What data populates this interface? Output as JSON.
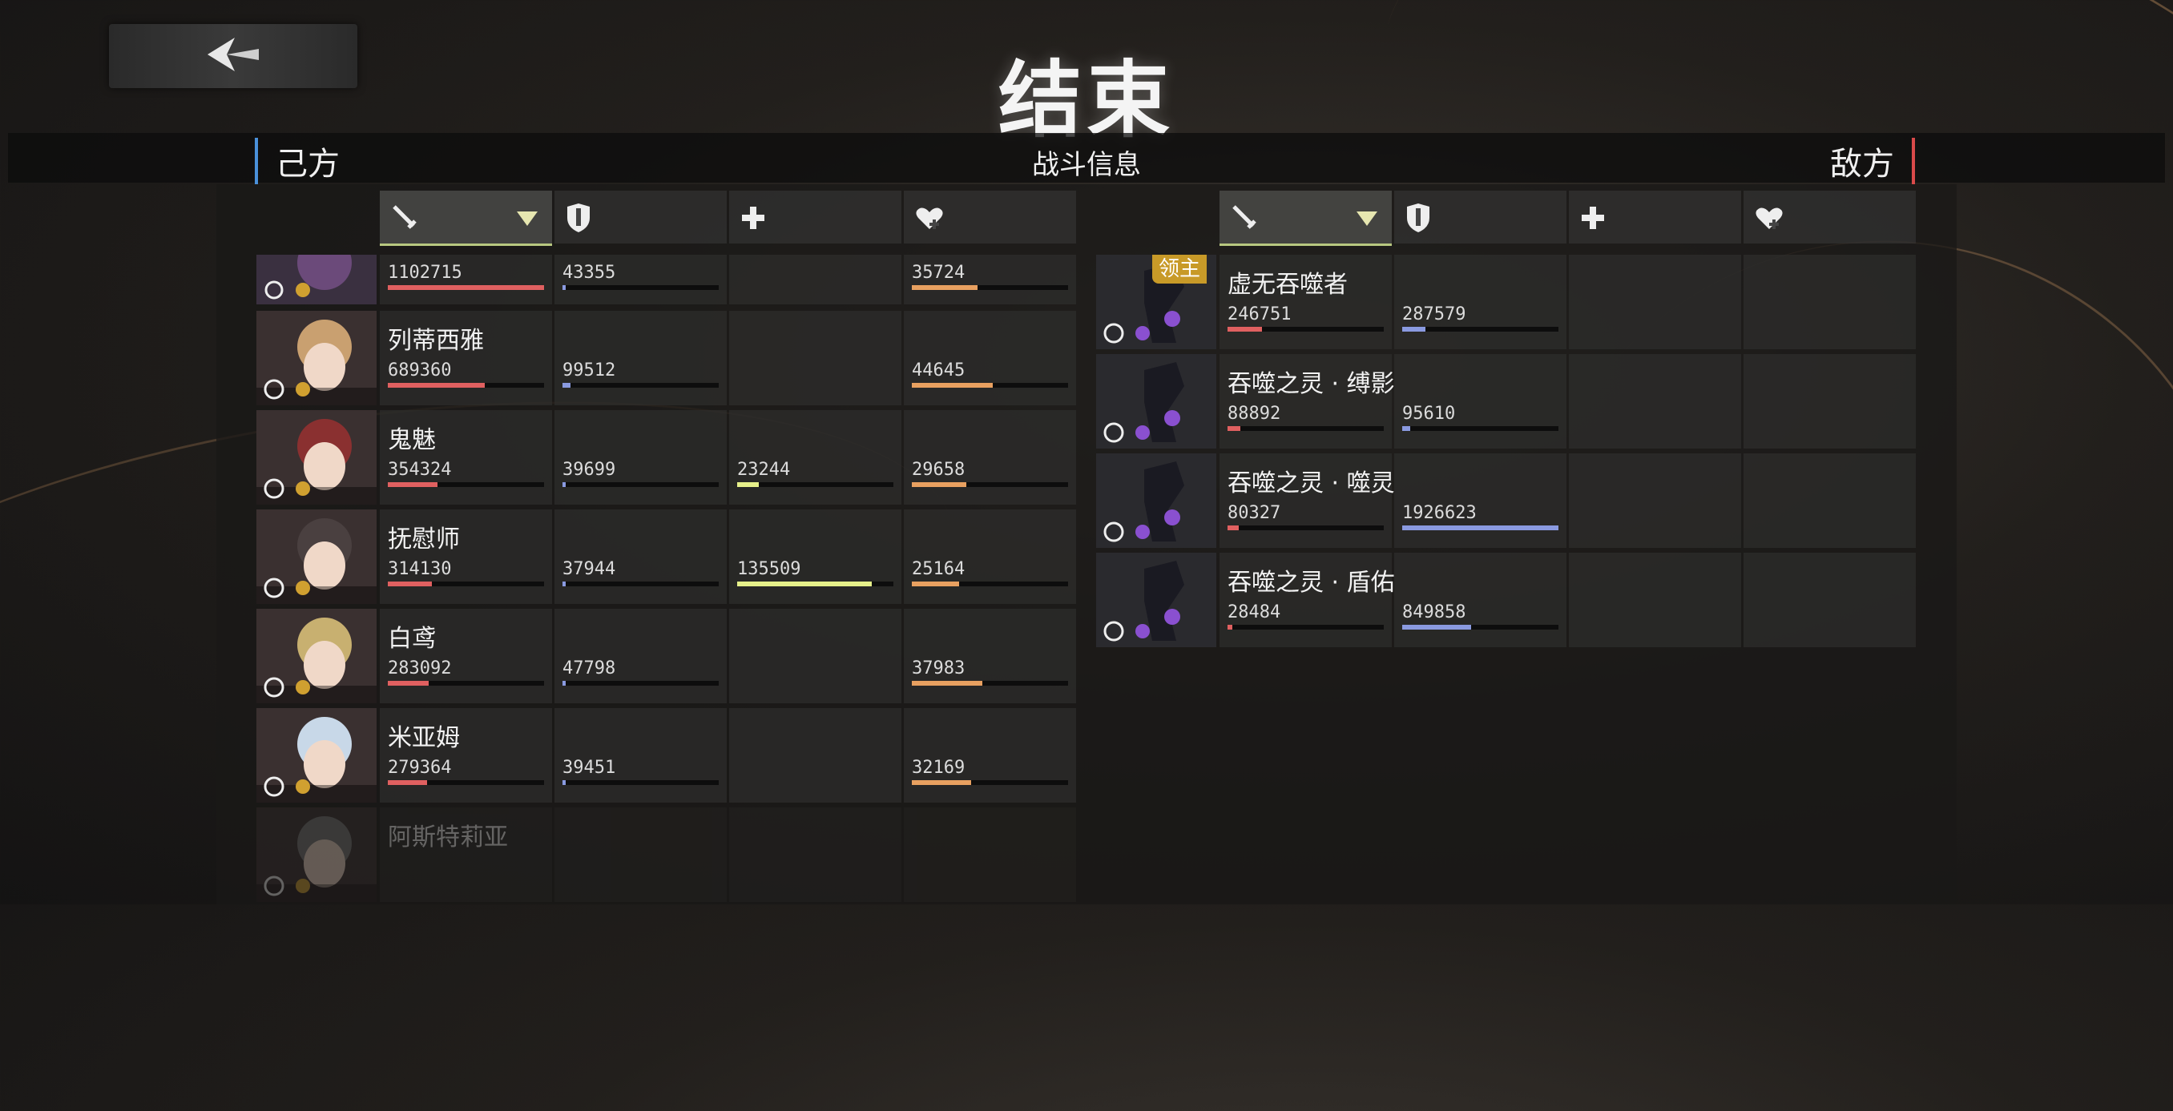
{
  "title": "结束",
  "header": {
    "ally_label": "己方",
    "center_label": "战斗信息",
    "enemy_label": "敌方"
  },
  "columns": {
    "icons": [
      "sword-icon",
      "shield-icon",
      "plus-icon",
      "heart-plus-icon"
    ],
    "sorted_column": "damage"
  },
  "colors": {
    "damage_bar": "#e06060",
    "defense_bar": "#8a9ae0",
    "heal_bar": "#e6f08a",
    "support_bar": "#e8a060"
  },
  "allies": [
    {
      "name": "",
      "damage": "1102715",
      "defense": "43355",
      "heal": "",
      "support": "35724",
      "damage_pct": 1.0,
      "defense_pct": 0.02,
      "heal_pct": 0,
      "support_pct": 0.42
    },
    {
      "name": "列蒂西雅",
      "damage": "689360",
      "defense": "99512",
      "heal": "",
      "support": "44645",
      "damage_pct": 0.62,
      "defense_pct": 0.05,
      "heal_pct": 0,
      "support_pct": 0.52
    },
    {
      "name": "鬼魅",
      "damage": "354324",
      "defense": "39699",
      "heal": "23244",
      "support": "29658",
      "damage_pct": 0.32,
      "defense_pct": 0.02,
      "heal_pct": 0.14,
      "support_pct": 0.35
    },
    {
      "name": "抚慰师",
      "damage": "314130",
      "defense": "37944",
      "heal": "135509",
      "support": "25164",
      "damage_pct": 0.28,
      "defense_pct": 0.02,
      "heal_pct": 0.86,
      "support_pct": 0.3
    },
    {
      "name": "白鸢",
      "damage": "283092",
      "defense": "47798",
      "heal": "",
      "support": "37983",
      "damage_pct": 0.26,
      "defense_pct": 0.02,
      "heal_pct": 0,
      "support_pct": 0.45
    },
    {
      "name": "米亚姆",
      "damage": "279364",
      "defense": "39451",
      "heal": "",
      "support": "32169",
      "damage_pct": 0.25,
      "defense_pct": 0.02,
      "heal_pct": 0,
      "support_pct": 0.38
    },
    {
      "name": "阿斯特莉亚",
      "damage": "",
      "defense": "",
      "heal": "",
      "support": "",
      "damage_pct": 0,
      "defense_pct": 0,
      "heal_pct": 0,
      "support_pct": 0
    }
  ],
  "enemies": [
    {
      "name": "虚无吞噬者",
      "badge": "领主",
      "damage": "246751",
      "defense": "287579",
      "damage_pct": 0.22,
      "defense_pct": 0.15
    },
    {
      "name": "吞噬之灵 · 缚影",
      "badge": "",
      "damage": "88892",
      "defense": "95610",
      "damage_pct": 0.08,
      "defense_pct": 0.05
    },
    {
      "name": "吞噬之灵 · 噬灵",
      "badge": "",
      "damage": "80327",
      "defense": "1926623",
      "damage_pct": 0.07,
      "defense_pct": 1.0
    },
    {
      "name": "吞噬之灵 · 盾佑",
      "badge": "",
      "damage": "28484",
      "defense": "849858",
      "damage_pct": 0.03,
      "defense_pct": 0.44
    }
  ]
}
